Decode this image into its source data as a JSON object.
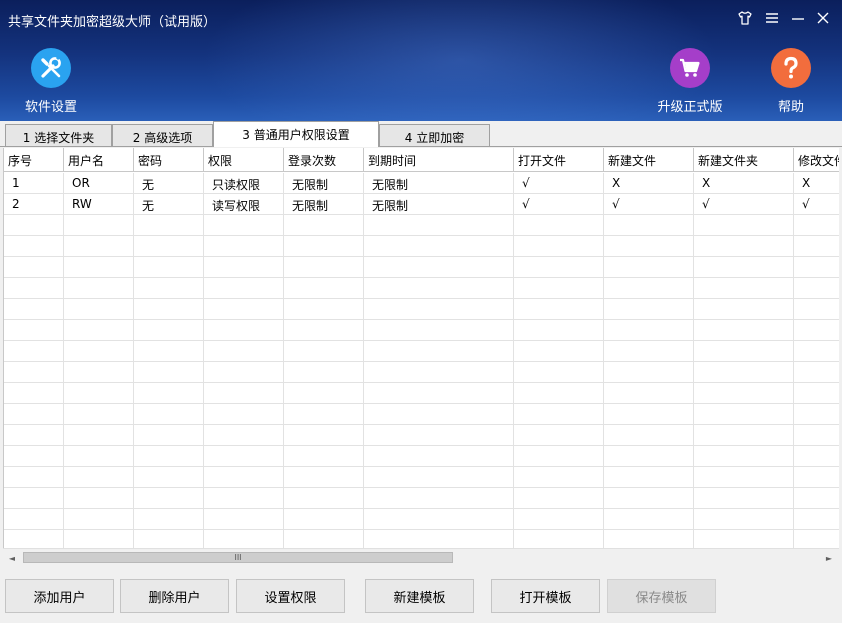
{
  "window": {
    "title": "共享文件夹加密超级大师（试用版）"
  },
  "header_buttons": {
    "settings": "软件设置",
    "upgrade": "升级正式版",
    "help": "帮助"
  },
  "colors": {
    "header_dark": "#0b1f5c",
    "settings_icon_bg": "#2aa3f0",
    "upgrade_icon_bg": "#a53ec9",
    "help_icon_bg": "#f26d3d"
  },
  "tabs": [
    {
      "label": "1 选择文件夹"
    },
    {
      "label": "2 高级选项"
    },
    {
      "label": "3 普通用户权限设置"
    },
    {
      "label": "4 立即加密"
    }
  ],
  "table": {
    "columns": [
      "序号",
      "用户名",
      "密码",
      "权限",
      "登录次数",
      "到期时间",
      "打开文件",
      "新建文件",
      "新建文件夹",
      "修改文件"
    ],
    "rows": [
      [
        "1",
        "OR",
        "无",
        "只读权限",
        "无限制",
        "无限制",
        "√",
        "X",
        "X",
        "X"
      ],
      [
        "2",
        "RW",
        "无",
        "读写权限",
        "无限制",
        "无限制",
        "√",
        "√",
        "√",
        "√"
      ]
    ]
  },
  "scrollbar": {
    "grip": "III",
    "left_arrow": "◄",
    "right_arrow": "►"
  },
  "buttons": {
    "add_user": "添加用户",
    "delete_user": "删除用户",
    "set_permission": "设置权限",
    "new_template": "新建模板",
    "open_template": "打开模板",
    "save_template": "保存模板"
  }
}
